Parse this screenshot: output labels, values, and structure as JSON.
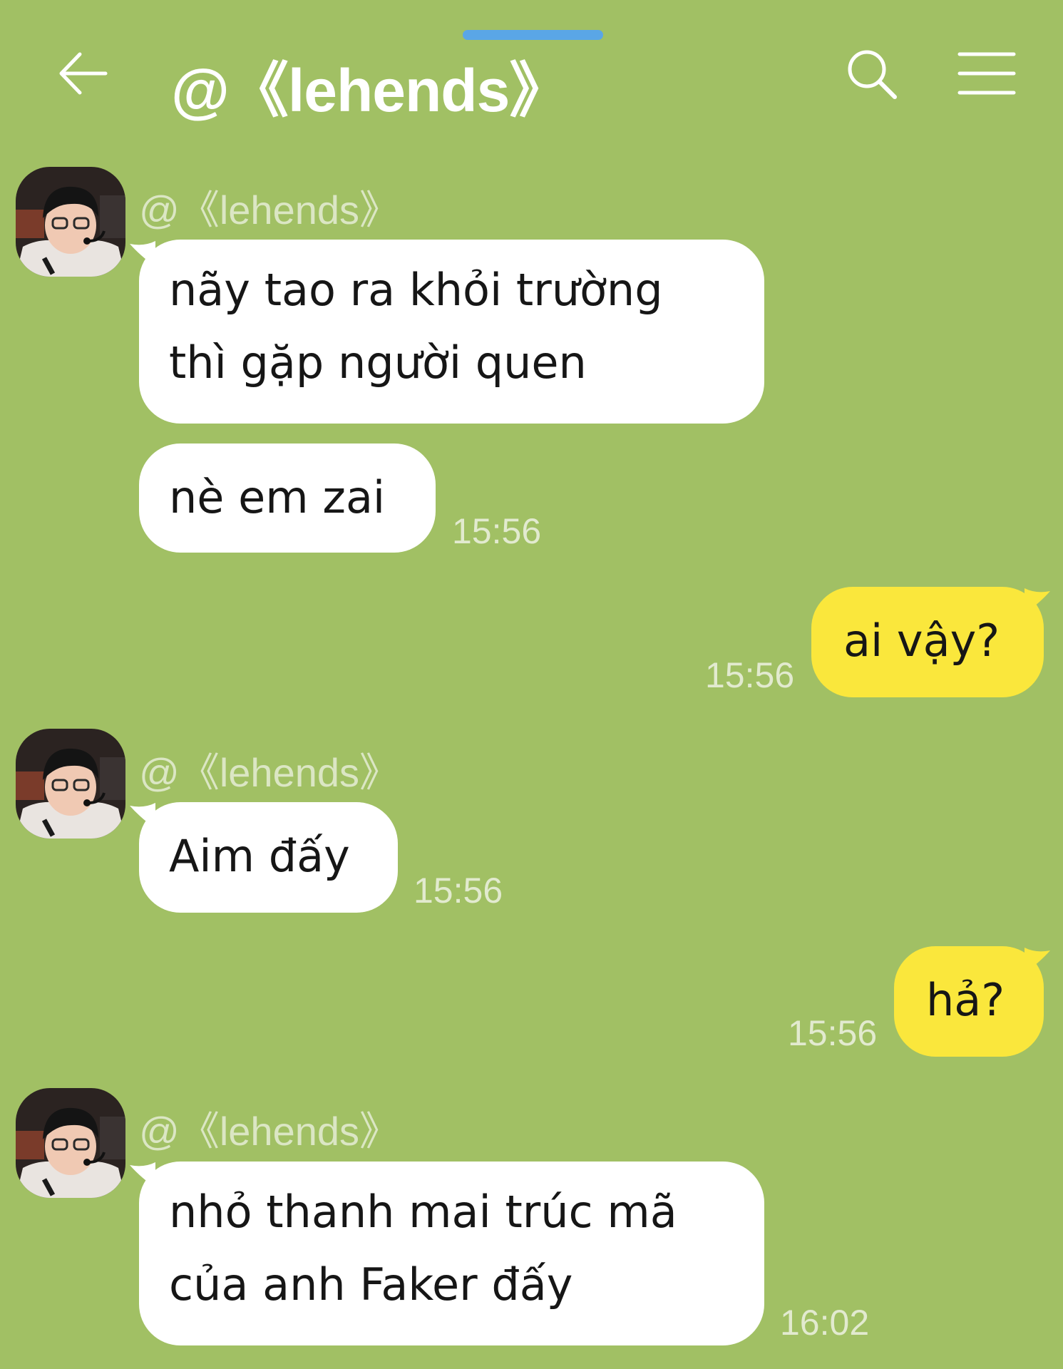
{
  "colors": {
    "background": "#a1c064",
    "incoming_bubble": "#ffffff",
    "outgoing_bubble": "#fae73c",
    "timestamp": "#e2eacf",
    "sender_name": "#dbe6c4",
    "grab_handle": "#5aa6e6"
  },
  "header": {
    "back_icon": "arrow-left-icon",
    "title": "@《lehends》",
    "search_icon": "search-icon",
    "menu_icon": "hamburger-menu-icon"
  },
  "messages": {
    "group1": {
      "sender": "@《lehends》",
      "bubble1_line1": "nãy tao ra khỏi trường",
      "bubble1_line2": "thì gặp người quen",
      "bubble2": "nè em zai",
      "time": "15:56"
    },
    "reply1": {
      "text": "ai vậy?",
      "time": "15:56"
    },
    "group2": {
      "sender": "@《lehends》",
      "bubble1": "Aim đấy",
      "time": "15:56"
    },
    "reply2": {
      "text": "hả?",
      "time": "15:56"
    },
    "group3": {
      "sender": "@《lehends》",
      "bubble1_line1": "nhỏ thanh mai trúc mã",
      "bubble1_line2": "của anh Faker đấy",
      "time": "16:02"
    }
  }
}
